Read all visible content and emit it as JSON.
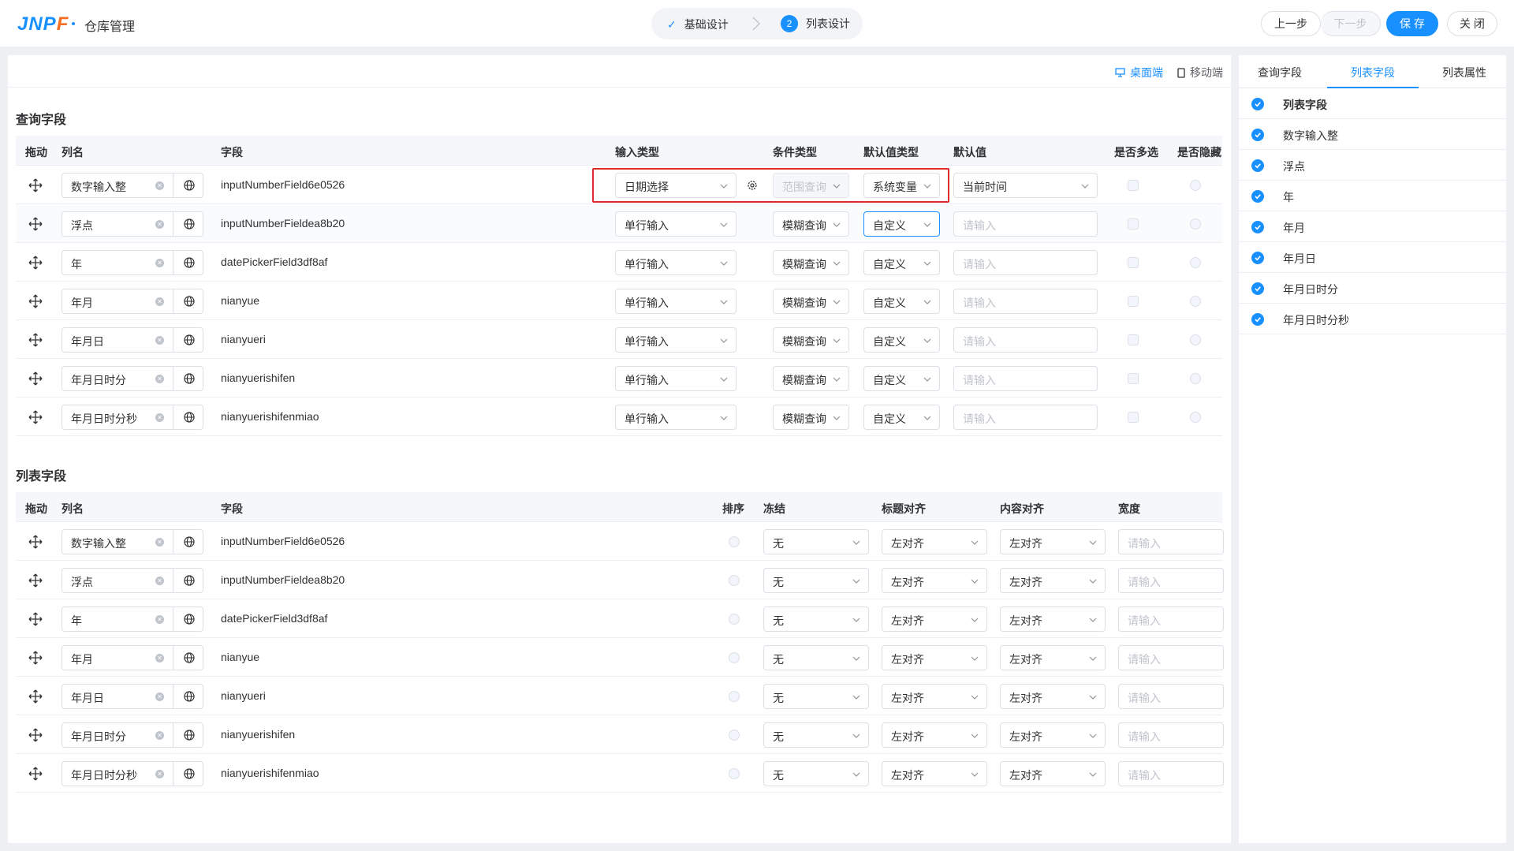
{
  "header": {
    "logo_main": "JNP",
    "logo_accent": "F",
    "app_title": "仓库管理",
    "step1_label": "基础设计",
    "step2_num": "2",
    "step2_label": "列表设计",
    "prev_label": "上一步",
    "next_label": "下一步",
    "save_label": "保 存",
    "close_label": "关 闭"
  },
  "devices": {
    "desktop": "桌面端",
    "mobile": "移动端"
  },
  "query": {
    "title": "查询字段",
    "headers": {
      "drag": "拖动",
      "name": "列名",
      "field": "字段",
      "input_type": "输入类型",
      "cond_type": "条件类型",
      "default_type": "默认值类型",
      "default_value": "默认值",
      "multi": "是否多选",
      "hidden": "是否隐藏"
    },
    "rows": [
      {
        "name": "数字输入整",
        "field": "inputNumberField6e0526",
        "input_type": "日期选择",
        "cond_type": "范围查询",
        "default_type": "系统变量",
        "default_value": "当前时间"
      },
      {
        "name": "浮点",
        "field": "inputNumberFieldea8b20",
        "input_type": "单行输入",
        "cond_type": "模糊查询",
        "default_type": "自定义",
        "default_value": ""
      },
      {
        "name": "年",
        "field": "datePickerField3df8af",
        "input_type": "单行输入",
        "cond_type": "模糊查询",
        "default_type": "自定义",
        "default_value": ""
      },
      {
        "name": "年月",
        "field": "nianyue",
        "input_type": "单行输入",
        "cond_type": "模糊查询",
        "default_type": "自定义",
        "default_value": ""
      },
      {
        "name": "年月日",
        "field": "nianyueri",
        "input_type": "单行输入",
        "cond_type": "模糊查询",
        "default_type": "自定义",
        "default_value": ""
      },
      {
        "name": "年月日时分",
        "field": "nianyuerishifen",
        "input_type": "单行输入",
        "cond_type": "模糊查询",
        "default_type": "自定义",
        "default_value": ""
      },
      {
        "name": "年月日时分秒",
        "field": "nianyuerishifenmiao",
        "input_type": "单行输入",
        "cond_type": "模糊查询",
        "default_type": "自定义",
        "default_value": ""
      }
    ],
    "placeholder": "请输入"
  },
  "list": {
    "title": "列表字段",
    "headers": {
      "drag": "拖动",
      "name": "列名",
      "field": "字段",
      "sort": "排序",
      "freeze": "冻结",
      "title_align": "标题对齐",
      "content_align": "内容对齐",
      "width": "宽度"
    },
    "rows": [
      {
        "name": "数字输入整",
        "field": "inputNumberField6e0526",
        "freeze": "无",
        "title_align": "左对齐",
        "content_align": "左对齐"
      },
      {
        "name": "浮点",
        "field": "inputNumberFieldea8b20",
        "freeze": "无",
        "title_align": "左对齐",
        "content_align": "左对齐"
      },
      {
        "name": "年",
        "field": "datePickerField3df8af",
        "freeze": "无",
        "title_align": "左对齐",
        "content_align": "左对齐"
      },
      {
        "name": "年月",
        "field": "nianyue",
        "freeze": "无",
        "title_align": "左对齐",
        "content_align": "左对齐"
      },
      {
        "name": "年月日",
        "field": "nianyueri",
        "freeze": "无",
        "title_align": "左对齐",
        "content_align": "左对齐"
      },
      {
        "name": "年月日时分",
        "field": "nianyuerishifen",
        "freeze": "无",
        "title_align": "左对齐",
        "content_align": "左对齐"
      },
      {
        "name": "年月日时分秒",
        "field": "nianyuerishifenmiao",
        "freeze": "无",
        "title_align": "左对齐",
        "content_align": "左对齐"
      }
    ],
    "placeholder": "请输入"
  },
  "side": {
    "tabs": [
      "查询字段",
      "列表字段",
      "列表属性"
    ],
    "active_tab": 1,
    "items": [
      "列表字段",
      "数字输入整",
      "浮点",
      "年",
      "年月",
      "年月日",
      "年月日时分",
      "年月日时分秒"
    ]
  },
  "colors": {
    "primary": "#1890ff",
    "highlight_box": "#e02a2a"
  }
}
